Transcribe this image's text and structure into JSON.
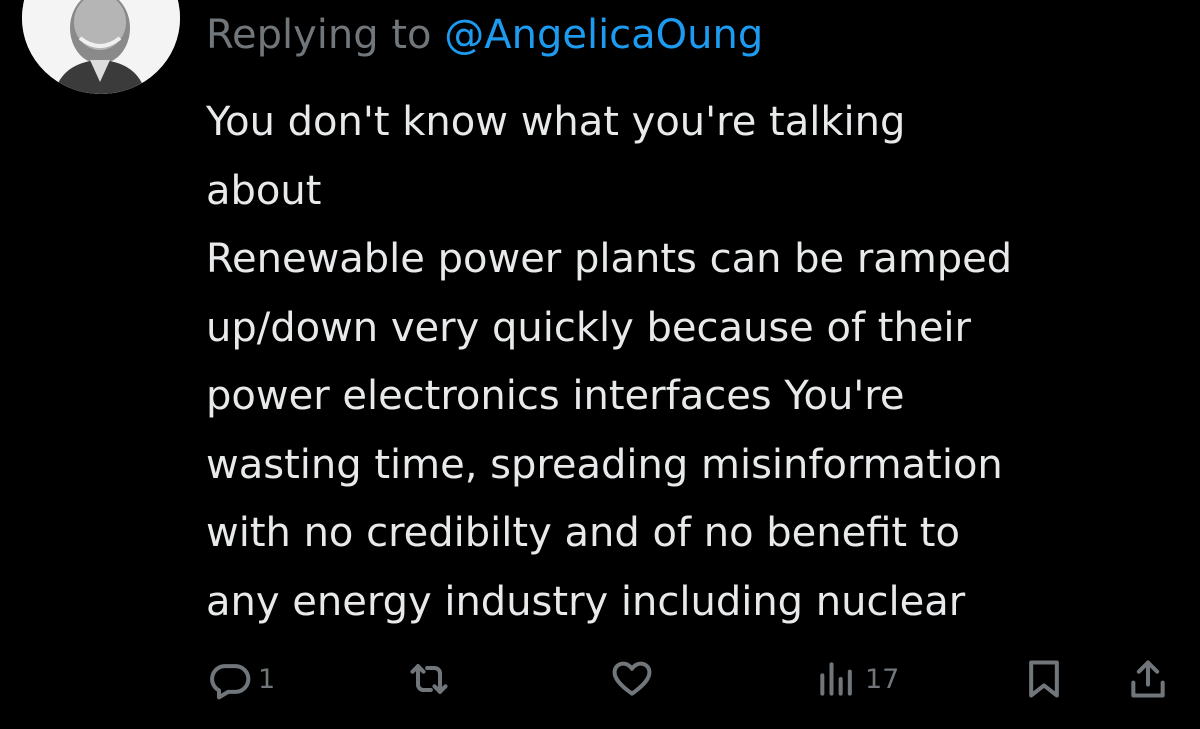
{
  "reply": {
    "prefix": "Replying to",
    "handle": "@AngelicaOung"
  },
  "tweet": {
    "lines": [
      "You don't know what you're talking",
      "about",
      "Renewable power plants can be ramped",
      "up/down very quickly because of their",
      "power electronics interfaces You're",
      "wasting time, spreading misinformation",
      "with no credibilty and of no benefit to",
      "any energy industry including nuclear"
    ]
  },
  "actions": {
    "reply": {
      "icon": "reply-icon",
      "count": "1"
    },
    "retweet": {
      "icon": "retweet-icon",
      "count": ""
    },
    "like": {
      "icon": "heart-icon",
      "count": ""
    },
    "views": {
      "icon": "views-icon",
      "count": "17"
    },
    "bookmark": {
      "icon": "bookmark-icon"
    },
    "share": {
      "icon": "share-icon"
    }
  },
  "colors": {
    "background": "#000000",
    "text": "#e7e9ea",
    "muted": "#71767b",
    "link": "#1d9bf0"
  }
}
